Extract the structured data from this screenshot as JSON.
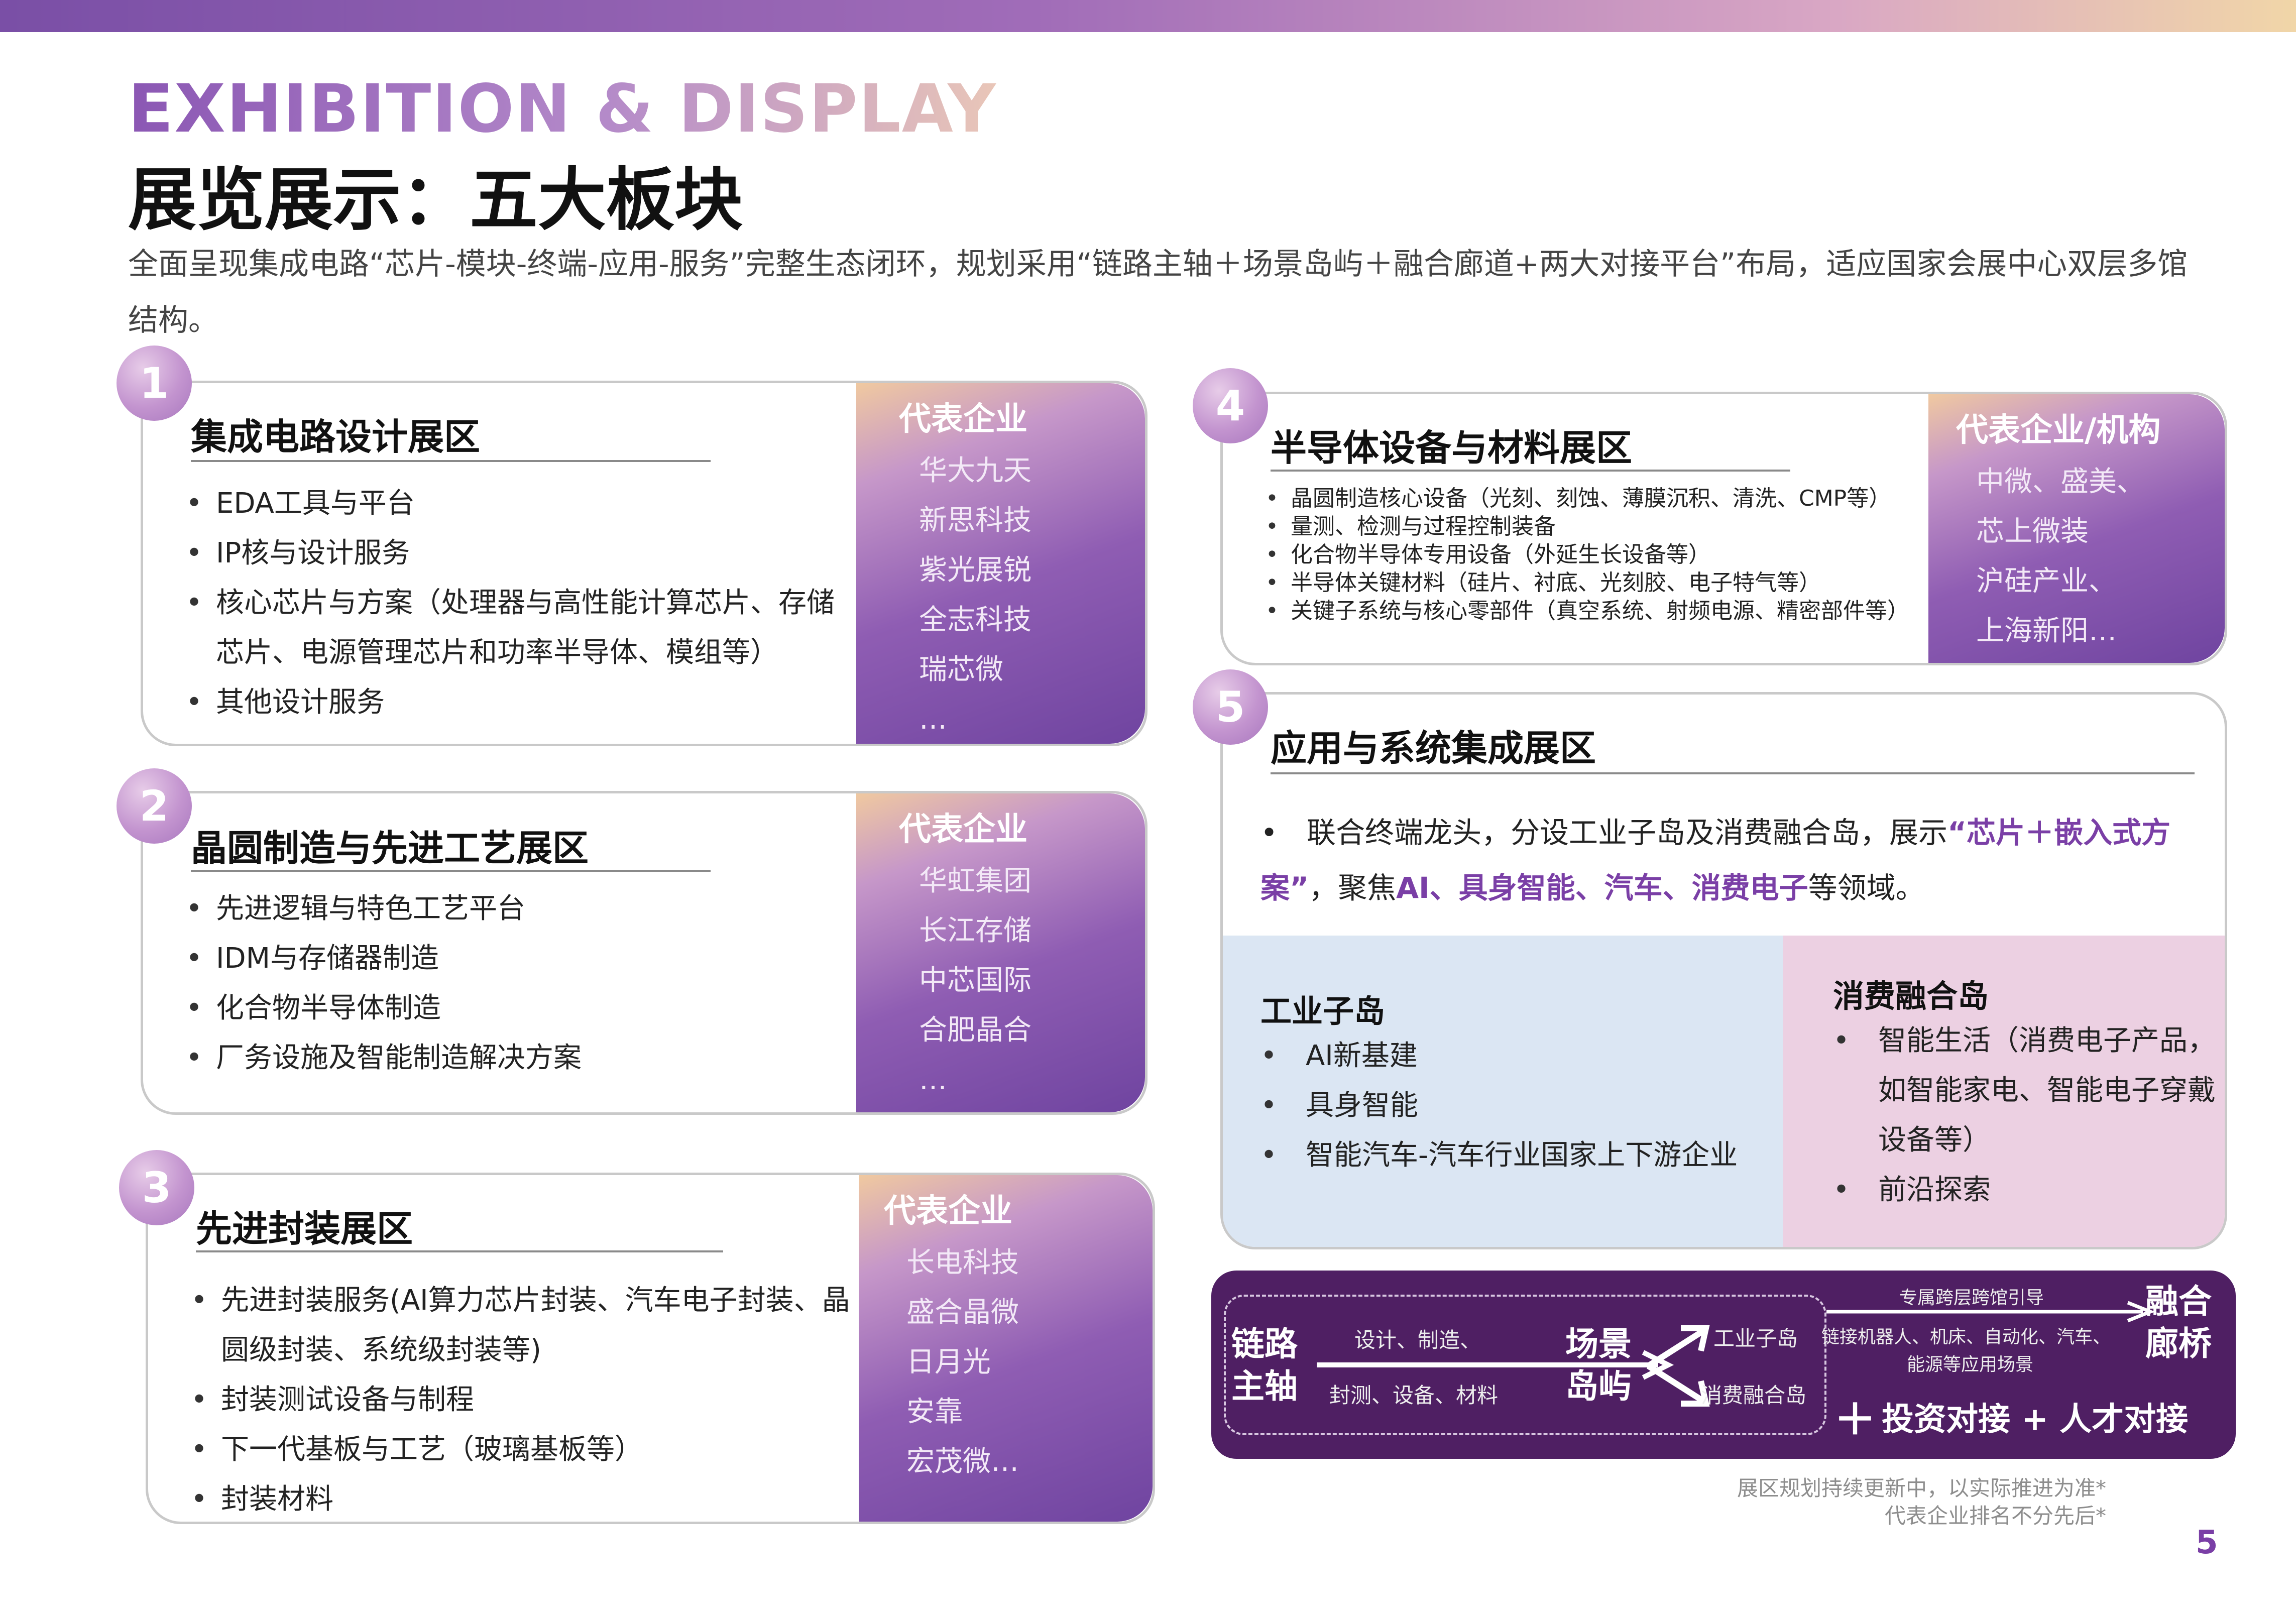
{
  "header": {
    "en_title": "EXHIBITION & DISPLAY",
    "cn_title": "展览展示：五大板块",
    "intro": "全面呈现集成电路“芯片-模块-终端-应用-服务”完整生态闭环，规划采用“链路主轴＋场景岛屿＋融合廊道+两大对接平台”布局，适应国家会展中心双层多馆结构。"
  },
  "zones": [
    {
      "number": "1",
      "title": "集成电路设计展区",
      "items": [
        "EDA工具与平台",
        "IP核与设计服务",
        "核心芯片与方案（处理器与高性能计算芯片、存储芯片、电源管理芯片和功率半导体、模组等）",
        "其他设计服务"
      ],
      "side_title": "代表企业",
      "companies": [
        "华大九天",
        "新思科技",
        "紫光展锐",
        "全志科技",
        "瑞芯微",
        "…"
      ]
    },
    {
      "number": "2",
      "title": "晶圆制造与先进工艺展区",
      "items": [
        "先进逻辑与特色工艺平台",
        "IDM与存储器制造",
        "化合物半导体制造",
        "厂务设施及智能制造解决方案"
      ],
      "side_title": "代表企业",
      "companies": [
        "华虹集团",
        "长江存储",
        "中芯国际",
        "合肥晶合",
        "…"
      ]
    },
    {
      "number": "3",
      "title": "先进封装展区",
      "items": [
        "先进封装服务(AI算力芯片封装、汽车电子封装、晶圆级封装、系统级封装等)",
        "封装测试设备与制程",
        "下一代基板与工艺（玻璃基板等）",
        "封装材料"
      ],
      "side_title": "代表企业",
      "companies": [
        "长电科技",
        "盛合晶微",
        "日月光",
        "安靠",
        "宏茂微…"
      ]
    },
    {
      "number": "4",
      "title": "半导体设备与材料展区",
      "items": [
        "晶圆制造核心设备（光刻、刻蚀、薄膜沉积、清洗、CMP等）",
        "量测、检测与过程控制装备",
        "化合物半导体专用设备（外延生长设备等）",
        "半导体关键材料（硅片、衬底、光刻胶、电子特气等）",
        "关键子系统与核心零部件（真空系统、射频电源、精密部件等）"
      ],
      "side_title": "代表企业/机构",
      "companies": [
        "中微、盛美、",
        "芯上微装",
        "沪硅产业、",
        "上海新阳…"
      ]
    }
  ],
  "zone5": {
    "number": "5",
    "title": "应用与系统集成展区",
    "desc_a": "联合终端龙头，分设工业子岛及消费融合岛，展示",
    "desc_b": "“芯片＋嵌入式方案”",
    "desc_c": "，聚焦",
    "desc_d": "AI、具身智能、汽车、消费电子",
    "desc_e": "等领域。",
    "industrial": {
      "title": "工业子岛",
      "items": [
        "AI新基建",
        "具身智能",
        "智能汽车-汽车行业国家上下游企业"
      ]
    },
    "consumer": {
      "title": "消费融合岛",
      "items": [
        "智能生活（消费电子产品，如智能家电、智能电子穿戴设备等）",
        "前沿探索"
      ]
    }
  },
  "flow": {
    "axis": [
      "链路",
      "主轴"
    ],
    "axis_top": "设计、制造、",
    "axis_bottom": "封测、设备、材料",
    "island": [
      "场景",
      "岛屿"
    ],
    "sub_industrial": "工业子岛",
    "sub_consumer": "消费融合岛",
    "guide": "专属跨层跨馆引导",
    "connect_a": "链接机器人、机床、自动化、汽车、",
    "connect_b": "能源等应用场景",
    "bridge": [
      "融合",
      "廊桥"
    ],
    "plus": "＋",
    "platform": "投资对接 + 人才对接"
  },
  "notes": [
    "展区规划持续更新中，以实际推进为准*",
    "代表企业排名不分先后*"
  ],
  "page_number": "5",
  "colors": {
    "accent": "#7a3fa6",
    "flow_bg": "#4f1f63",
    "industrial_bg": "#dbe6f3",
    "consumer_bg": "#ecd0e2"
  }
}
